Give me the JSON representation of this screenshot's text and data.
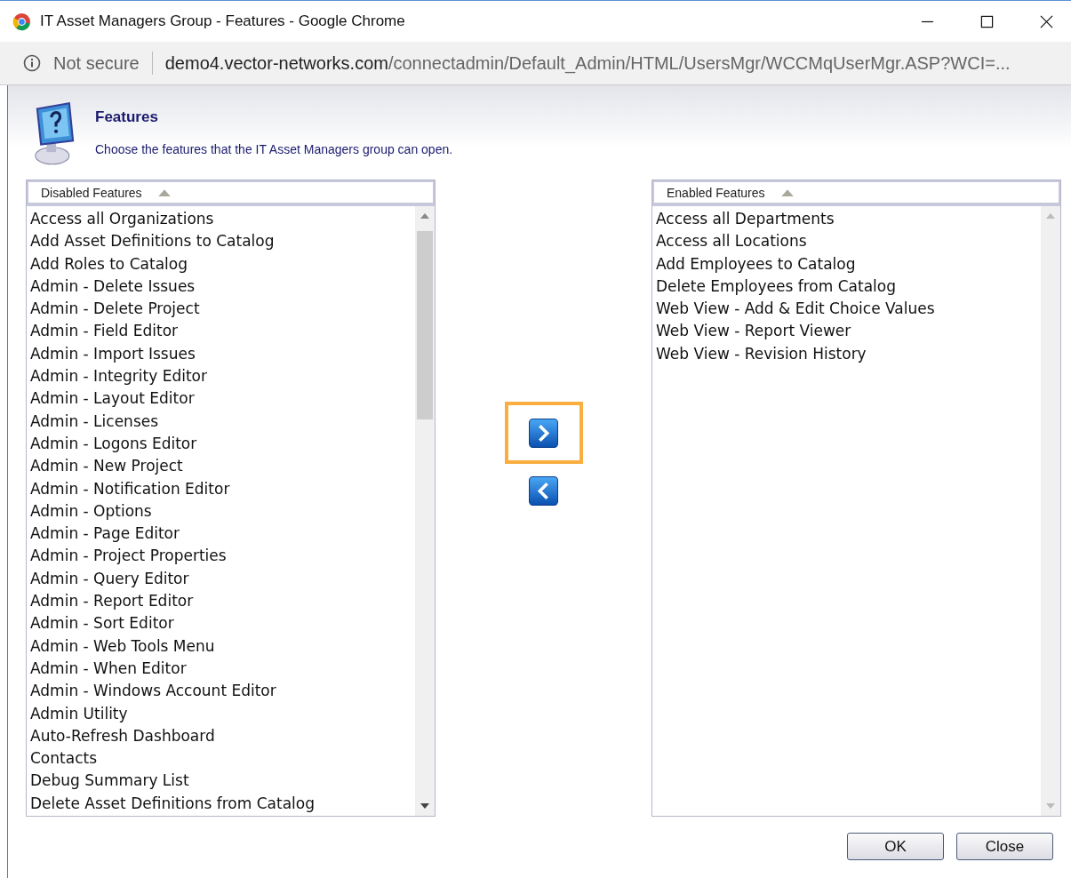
{
  "window": {
    "title": "IT Asset Managers Group - Features - Google Chrome"
  },
  "address_bar": {
    "security": "Not secure",
    "host": "demo4.vector-networks.com",
    "path": "/connectadmin/Default_Admin/HTML/UsersMgr/WCCMqUserMgr.ASP?WCI=..."
  },
  "header": {
    "title": "Features",
    "description": "Choose the features that the IT Asset Managers group can open."
  },
  "disabled_list": {
    "heading": "Disabled Features",
    "items": [
      "Access all Organizations",
      "Add Asset Definitions to Catalog",
      "Add Roles to Catalog",
      "Admin - Delete Issues",
      "Admin - Delete Project",
      "Admin - Field Editor",
      "Admin - Import Issues",
      "Admin - Integrity Editor",
      "Admin - Layout Editor",
      "Admin - Licenses",
      "Admin - Logons Editor",
      "Admin - New Project",
      "Admin - Notification Editor",
      "Admin - Options",
      "Admin - Page Editor",
      "Admin - Project Properties",
      "Admin - Query Editor",
      "Admin - Report Editor",
      "Admin - Sort Editor",
      "Admin - Web Tools Menu",
      "Admin - When Editor",
      "Admin - Windows Account Editor",
      "Admin Utility",
      "Auto-Refresh Dashboard",
      "Contacts",
      "Debug Summary List",
      "Delete Asset Definitions from Catalog"
    ]
  },
  "move_buttons": [
    {
      "kind": "enable",
      "highlighted": true
    },
    {
      "kind": "disable",
      "highlighted": false
    }
  ],
  "enabled_list": {
    "heading": "Enabled Features",
    "items": [
      "Access all Departments",
      "Access all Locations",
      "Add Employees to Catalog",
      "Delete Employees from Catalog",
      "Web View - Add & Edit Choice Values",
      "Web View - Report Viewer",
      "Web View - Revision History"
    ]
  },
  "buttons": [
    "OK",
    "Close"
  ]
}
